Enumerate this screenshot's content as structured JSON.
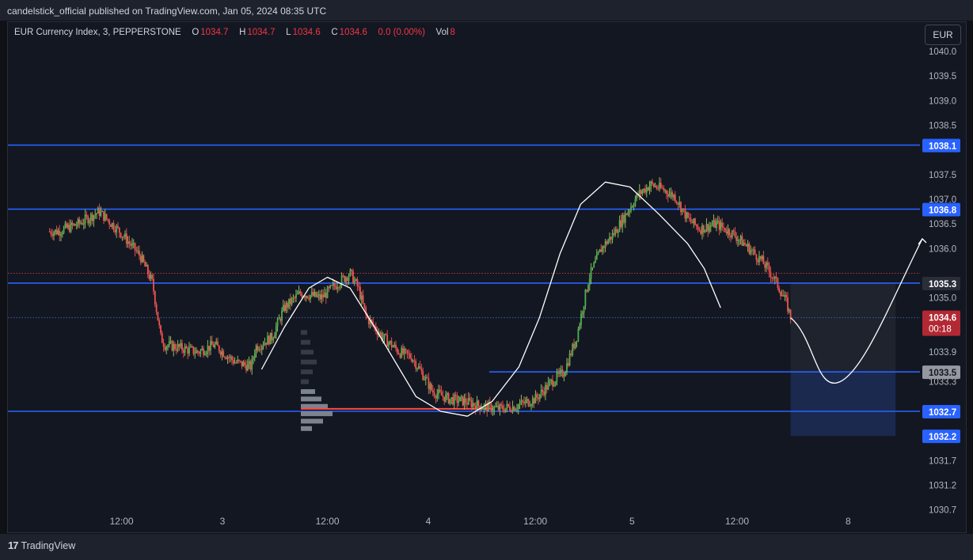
{
  "header": {
    "published_text": "candelstick_official published on TradingView.com, Jan 05, 2024 08:35 UTC"
  },
  "legend": {
    "symbol": "EUR Currency Index, 3, PEPPERSTONE",
    "o_label": "O",
    "o_value": "1034.7",
    "h_label": "H",
    "h_value": "1034.7",
    "l_label": "L",
    "l_value": "1034.6",
    "c_label": "C",
    "c_value": "1034.6",
    "change": "0.0 (0.00%)",
    "vol_label": "Vol",
    "vol_value": "8"
  },
  "currency_button": "EUR",
  "branding": {
    "logo_mark": "17",
    "name": "TradingView"
  },
  "colors": {
    "background": "#131722",
    "level_line": "#2962ff",
    "up_candle": "#26a69a",
    "up_candle_wick": "#4caf50",
    "down_candle": "#ef5350",
    "price_label": "#b22833",
    "path_curve": "#ffffff",
    "target_box": "#1b2a52"
  },
  "chart_data": {
    "type": "candlestick",
    "symbol": "EUR Currency Index",
    "timeframe": "3",
    "broker": "PEPPERSTONE",
    "y_axis": {
      "ticks": [
        "1040.0",
        "1039.5",
        "1039.0",
        "1038.5",
        "1037.5",
        "1037.0",
        "1036.5",
        "1036.0",
        "1035.0",
        "1033.9",
        "1033.3",
        "1031.7",
        "1031.2",
        "1030.7"
      ],
      "range": [
        1030.7,
        1040.0
      ]
    },
    "x_axis": {
      "ticks": [
        "12:00",
        "3",
        "12:00",
        "4",
        "12:00",
        "5",
        "12:00",
        "8"
      ]
    },
    "current_price": "1034.6",
    "countdown": "00:18",
    "levels": [
      {
        "label": "1038.1",
        "value": 1038.1,
        "style": "solid-blue"
      },
      {
        "label": "1036.8",
        "value": 1036.8,
        "style": "solid-blue"
      },
      {
        "label": "1035.3",
        "value": 1035.3,
        "style": "solid-blue"
      },
      {
        "label": "1033.5",
        "value": 1033.5,
        "style": "solid-blue"
      },
      {
        "label": "1032.7",
        "value": 1032.7,
        "style": "solid-blue"
      },
      {
        "label": "1032.2",
        "value": 1032.2,
        "style": "target-box-bottom"
      }
    ],
    "dotted_lines": [
      {
        "value": 1035.5,
        "color": "red"
      },
      {
        "value": 1034.6,
        "color": "blue"
      }
    ],
    "price_path": [
      [
        0.2,
        1036.35
      ],
      [
        0.3,
        1036.5
      ],
      [
        0.4,
        1036.75
      ],
      [
        0.5,
        1036.35
      ],
      [
        0.6,
        1035.85
      ],
      [
        0.66,
        1035.3
      ],
      [
        0.7,
        1034.2
      ],
      [
        0.72,
        1034.05
      ],
      [
        0.78,
        1034.0
      ],
      [
        0.88,
        1033.9
      ],
      [
        0.96,
        1034.05
      ],
      [
        1.06,
        1033.7
      ],
      [
        1.14,
        1033.6
      ],
      [
        1.16,
        1034.0
      ],
      [
        1.24,
        1034.2
      ],
      [
        1.3,
        1034.8
      ],
      [
        1.38,
        1035.1
      ],
      [
        1.48,
        1035.0
      ],
      [
        1.56,
        1035.3
      ],
      [
        1.62,
        1035.5
      ],
      [
        1.66,
        1035.2
      ],
      [
        1.7,
        1034.6
      ],
      [
        1.74,
        1034.4
      ],
      [
        1.78,
        1034.2
      ],
      [
        1.86,
        1033.9
      ],
      [
        1.92,
        1033.8
      ],
      [
        1.98,
        1033.4
      ],
      [
        2.02,
        1033.1
      ],
      [
        2.1,
        1032.95
      ],
      [
        2.18,
        1032.9
      ],
      [
        2.26,
        1032.8
      ],
      [
        2.34,
        1032.75
      ],
      [
        2.42,
        1032.8
      ],
      [
        2.52,
        1032.95
      ],
      [
        2.6,
        1033.3
      ],
      [
        2.66,
        1033.5
      ],
      [
        2.72,
        1034.2
      ],
      [
        2.78,
        1035.4
      ],
      [
        2.84,
        1036.0
      ],
      [
        2.9,
        1036.3
      ],
      [
        2.96,
        1036.7
      ],
      [
        3.02,
        1037.1
      ],
      [
        3.08,
        1037.3
      ],
      [
        3.14,
        1037.2
      ],
      [
        3.2,
        1037.05
      ],
      [
        3.26,
        1036.6
      ],
      [
        3.32,
        1036.4
      ],
      [
        3.4,
        1036.5
      ],
      [
        3.48,
        1036.3
      ],
      [
        3.56,
        1036.0
      ],
      [
        3.62,
        1035.75
      ],
      [
        3.68,
        1035.4
      ],
      [
        3.74,
        1034.9
      ],
      [
        3.76,
        1034.6
      ]
    ],
    "volume_profile": {
      "poc_price": 1032.75,
      "bars": [
        1034.3,
        1034.1,
        1033.9,
        1033.7,
        1033.5,
        1033.3,
        1033.1,
        1032.95,
        1032.8,
        1032.65,
        1032.5,
        1032.35
      ]
    },
    "projection": {
      "curve": [
        [
          3.76,
          1034.6
        ],
        [
          4.0,
          1033.3
        ],
        [
          4.15,
          1034.3
        ],
        [
          4.4,
          1036.2
        ]
      ],
      "target_box": {
        "top": 1035.3,
        "bottom": 1032.2,
        "start": 3.76,
        "end": 4.27
      }
    }
  }
}
